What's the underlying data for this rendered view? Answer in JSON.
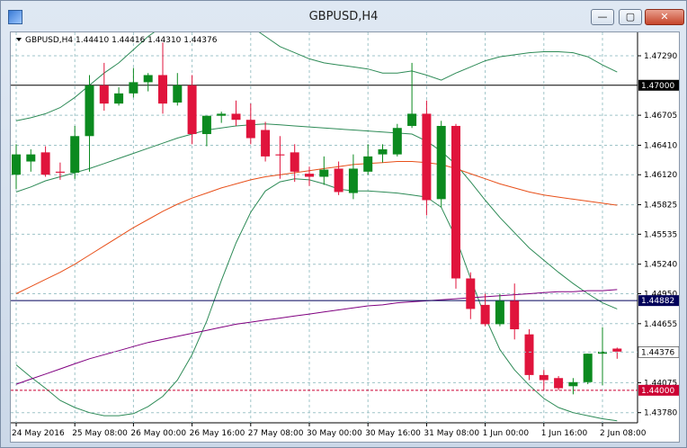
{
  "window": {
    "title": "GBPUSD,H4",
    "buttons": {
      "minimize": "—",
      "maximize": "▢",
      "close": "✕"
    }
  },
  "chart_data": {
    "type": "candlestick",
    "symbol": "GBPUSD",
    "timeframe": "H4",
    "ohlc_label": "GBPUSD,H4  1.44410 1.44416 1.44310 1.44376",
    "ylim": [
      1.4368,
      1.4752
    ],
    "price_ticks": [
      "1.47290",
      "1.46705",
      "1.46410",
      "1.46120",
      "1.45825",
      "1.45535",
      "1.45240",
      "1.44950",
      "1.44655",
      "1.44075",
      "1.43780"
    ],
    "time_labels": [
      "24 May 2016",
      "25 May 08:00",
      "26 May 00:00",
      "26 May 16:00",
      "27 May 08:00",
      "30 May 00:00",
      "30 May 16:00",
      "31 May 08:00",
      "1 Jun 00:00",
      "1 Jun 16:00",
      "2 Jun 08:00"
    ],
    "levels": [
      {
        "name": "h-line-1",
        "price": 1.47,
        "label": "1.47000",
        "style": "solid",
        "color": "#000000"
      },
      {
        "name": "h-line-2",
        "price": 1.44882,
        "label": "1.44882",
        "style": "solid",
        "color": "#00005a"
      },
      {
        "name": "h-line-3",
        "price": 1.44,
        "label": "1.44000",
        "style": "dashed",
        "color": "#cc0033"
      }
    ],
    "current_price": {
      "price": 1.44376,
      "label": "1.44376"
    },
    "candles": [
      {
        "o": 1.4612,
        "h": 1.4642,
        "l": 1.4598,
        "c": 1.4632
      },
      {
        "o": 1.4625,
        "h": 1.4637,
        "l": 1.4615,
        "c": 1.4632
      },
      {
        "o": 1.4634,
        "h": 1.464,
        "l": 1.461,
        "c": 1.4612
      },
      {
        "o": 1.4615,
        "h": 1.4624,
        "l": 1.4607,
        "c": 1.4614
      },
      {
        "o": 1.4614,
        "h": 1.466,
        "l": 1.4608,
        "c": 1.465
      },
      {
        "o": 1.465,
        "h": 1.471,
        "l": 1.4615,
        "c": 1.47
      },
      {
        "o": 1.47,
        "h": 1.4722,
        "l": 1.4675,
        "c": 1.4682
      },
      {
        "o": 1.4682,
        "h": 1.4698,
        "l": 1.468,
        "c": 1.4692
      },
      {
        "o": 1.4692,
        "h": 1.4717,
        "l": 1.4688,
        "c": 1.4703
      },
      {
        "o": 1.4703,
        "h": 1.4712,
        "l": 1.4694,
        "c": 1.471
      },
      {
        "o": 1.471,
        "h": 1.4742,
        "l": 1.4672,
        "c": 1.4682
      },
      {
        "o": 1.4683,
        "h": 1.4712,
        "l": 1.468,
        "c": 1.47
      },
      {
        "o": 1.47,
        "h": 1.471,
        "l": 1.4642,
        "c": 1.4652
      },
      {
        "o": 1.4652,
        "h": 1.467,
        "l": 1.464,
        "c": 1.467
      },
      {
        "o": 1.467,
        "h": 1.4674,
        "l": 1.4663,
        "c": 1.4672
      },
      {
        "o": 1.4672,
        "h": 1.4685,
        "l": 1.466,
        "c": 1.4666
      },
      {
        "o": 1.4666,
        "h": 1.4682,
        "l": 1.4642,
        "c": 1.4648
      },
      {
        "o": 1.4656,
        "h": 1.4664,
        "l": 1.4625,
        "c": 1.463
      },
      {
        "o": 1.4632,
        "h": 1.465,
        "l": 1.4608,
        "c": 1.4631
      },
      {
        "o": 1.4634,
        "h": 1.4642,
        "l": 1.4605,
        "c": 1.4615
      },
      {
        "o": 1.4613,
        "h": 1.462,
        "l": 1.4601,
        "c": 1.461
      },
      {
        "o": 1.461,
        "h": 1.463,
        "l": 1.4602,
        "c": 1.4617
      },
      {
        "o": 1.4618,
        "h": 1.4625,
        "l": 1.4592,
        "c": 1.4595
      },
      {
        "o": 1.4594,
        "h": 1.4632,
        "l": 1.4588,
        "c": 1.4618
      },
      {
        "o": 1.4615,
        "h": 1.4642,
        "l": 1.4612,
        "c": 1.463
      },
      {
        "o": 1.4632,
        "h": 1.4642,
        "l": 1.4624,
        "c": 1.4637
      },
      {
        "o": 1.4632,
        "h": 1.4662,
        "l": 1.463,
        "c": 1.4658
      },
      {
        "o": 1.466,
        "h": 1.4722,
        "l": 1.4658,
        "c": 1.4672
      },
      {
        "o": 1.4672,
        "h": 1.4685,
        "l": 1.4572,
        "c": 1.4587
      },
      {
        "o": 1.4588,
        "h": 1.4665,
        "l": 1.458,
        "c": 1.466
      },
      {
        "o": 1.466,
        "h": 1.4662,
        "l": 1.45,
        "c": 1.451
      },
      {
        "o": 1.451,
        "h": 1.4516,
        "l": 1.447,
        "c": 1.448
      },
      {
        "o": 1.4484,
        "h": 1.4495,
        "l": 1.4463,
        "c": 1.4465
      },
      {
        "o": 1.4465,
        "h": 1.4495,
        "l": 1.4463,
        "c": 1.4488
      },
      {
        "o": 1.4488,
        "h": 1.4505,
        "l": 1.445,
        "c": 1.446
      },
      {
        "o": 1.4455,
        "h": 1.446,
        "l": 1.441,
        "c": 1.4415
      },
      {
        "o": 1.4415,
        "h": 1.442,
        "l": 1.44,
        "c": 1.441
      },
      {
        "o": 1.4412,
        "h": 1.4414,
        "l": 1.44,
        "c": 1.4402
      },
      {
        "o": 1.4404,
        "h": 1.4412,
        "l": 1.4396,
        "c": 1.4408
      },
      {
        "o": 1.4408,
        "h": 1.4436,
        "l": 1.4406,
        "c": 1.4436
      },
      {
        "o": 1.4436,
        "h": 1.4462,
        "l": 1.4405,
        "c": 1.4438
      },
      {
        "o": 1.4441,
        "h": 1.4442,
        "l": 1.4431,
        "c": 1.4438
      }
    ],
    "indicators": [
      {
        "name": "bollinger-upper",
        "color": "#2e8b57",
        "values": [
          1.4665,
          1.4668,
          1.4672,
          1.4678,
          1.4688,
          1.47,
          1.4712,
          1.4722,
          1.4735,
          1.4748,
          1.4758,
          1.4765,
          1.4768,
          1.477,
          1.4768,
          1.4764,
          1.4758,
          1.4748,
          1.4738,
          1.4732,
          1.4726,
          1.4722,
          1.472,
          1.4718,
          1.4716,
          1.4712,
          1.4712,
          1.4714,
          1.471,
          1.4705,
          1.4712,
          1.4718,
          1.4724,
          1.4728,
          1.473,
          1.4732,
          1.4733,
          1.4733,
          1.4732,
          1.4728,
          1.472,
          1.4713
        ]
      },
      {
        "name": "bollinger-mid",
        "color": "#2e8b57",
        "values": [
          1.4595,
          1.46,
          1.4606,
          1.461,
          1.4614,
          1.4618,
          1.4623,
          1.4628,
          1.4633,
          1.4638,
          1.4643,
          1.4648,
          1.4652,
          1.4656,
          1.4658,
          1.466,
          1.4661,
          1.4662,
          1.4661,
          1.466,
          1.4659,
          1.4658,
          1.4657,
          1.4656,
          1.4655,
          1.4654,
          1.4653,
          1.4652,
          1.4645,
          1.4635,
          1.4622,
          1.4605,
          1.4587,
          1.457,
          1.4555,
          1.454,
          1.4528,
          1.4516,
          1.4505,
          1.4495,
          1.4486,
          1.448
        ]
      },
      {
        "name": "bollinger-lower",
        "color": "#2e8b57",
        "values": [
          1.4425,
          1.4413,
          1.4402,
          1.439,
          1.4383,
          1.4378,
          1.4375,
          1.4375,
          1.4377,
          1.4384,
          1.4394,
          1.441,
          1.4435,
          1.4468,
          1.4508,
          1.4545,
          1.4575,
          1.4596,
          1.4605,
          1.4608,
          1.4607,
          1.4603,
          1.4598,
          1.4596,
          1.4596,
          1.4595,
          1.4594,
          1.4592,
          1.459,
          1.458,
          1.455,
          1.451,
          1.4472,
          1.444,
          1.442,
          1.4405,
          1.4392,
          1.4383,
          1.4378,
          1.4375,
          1.4372,
          1.437
        ]
      },
      {
        "name": "moving-average-orange",
        "color": "#e8501a",
        "values": [
          1.4495,
          1.4502,
          1.4509,
          1.4516,
          1.4524,
          1.4533,
          1.4542,
          1.4551,
          1.456,
          1.4568,
          1.4576,
          1.4583,
          1.4589,
          1.4594,
          1.4599,
          1.4603,
          1.4607,
          1.461,
          1.4612,
          1.4614,
          1.4616,
          1.4618,
          1.462,
          1.4622,
          1.4623,
          1.4624,
          1.4625,
          1.4625,
          1.4624,
          1.4622,
          1.4618,
          1.4613,
          1.4608,
          1.4603,
          1.4599,
          1.4595,
          1.4592,
          1.459,
          1.4588,
          1.4586,
          1.4584,
          1.4582
        ]
      },
      {
        "name": "moving-average-purple",
        "color": "#800080",
        "values": [
          1.4406,
          1.4411,
          1.4416,
          1.4421,
          1.4426,
          1.4431,
          1.4435,
          1.4439,
          1.4443,
          1.4447,
          1.445,
          1.4453,
          1.4456,
          1.4459,
          1.4462,
          1.4465,
          1.4467,
          1.4469,
          1.4471,
          1.4473,
          1.4475,
          1.4477,
          1.4479,
          1.4481,
          1.4483,
          1.4484,
          1.4486,
          1.4487,
          1.4488,
          1.4489,
          1.449,
          1.4491,
          1.4492,
          1.4493,
          1.4494,
          1.4495,
          1.4496,
          1.4497,
          1.4497,
          1.4498,
          1.4498,
          1.4499
        ]
      }
    ]
  }
}
